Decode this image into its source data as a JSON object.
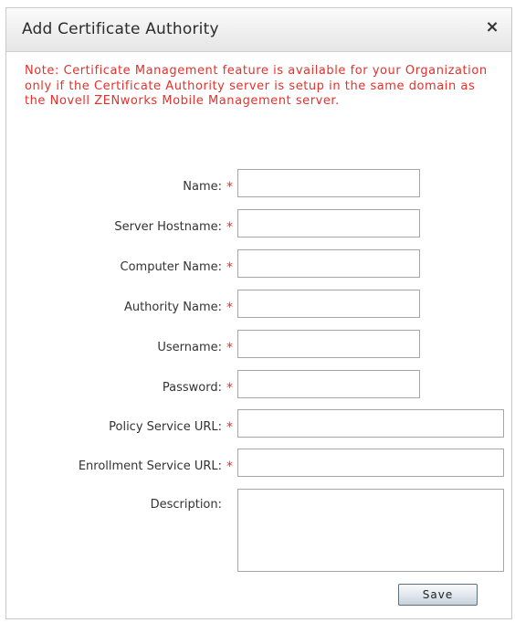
{
  "dialog": {
    "title": "Add Certificate Authority",
    "close_glyph": "×",
    "note": "Note: Certificate Management feature is available for your Organization only if the Certificate Authority server is setup in the same domain as the Novell ZENworks Mobile Management server.",
    "required_marker": "*",
    "fields": {
      "name": {
        "label": "Name:",
        "value": ""
      },
      "server_hostname": {
        "label": "Server Hostname:",
        "value": ""
      },
      "computer_name": {
        "label": "Computer Name:",
        "value": ""
      },
      "authority_name": {
        "label": "Authority Name:",
        "value": ""
      },
      "username": {
        "label": "Username:",
        "value": ""
      },
      "password": {
        "label": "Password:",
        "value": ""
      },
      "policy_service_url": {
        "label": "Policy Service URL:",
        "value": ""
      },
      "enrollment_service_url": {
        "label": "Enrollment Service URL:",
        "value": ""
      },
      "description": {
        "label": "Description:",
        "value": ""
      }
    },
    "save_label": "Save"
  },
  "colors": {
    "accent_red": "#e4312b",
    "border": "#a6a6a6"
  },
  "icons": {
    "close": "close-icon"
  }
}
